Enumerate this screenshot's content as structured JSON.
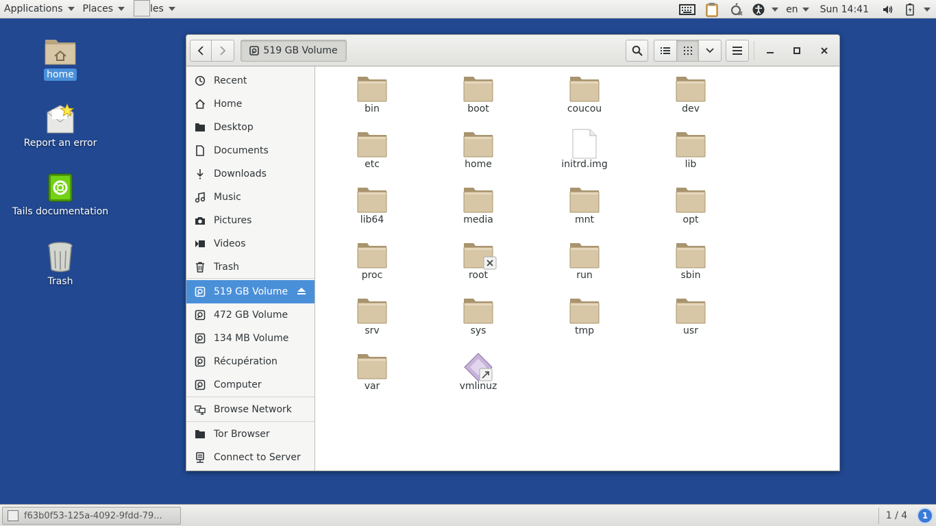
{
  "topbar": {
    "applications": "Applications",
    "places": "Places",
    "files": "Files",
    "lang": "en",
    "clock": "Sun 14:41"
  },
  "desktop": {
    "icons": [
      {
        "label": "home",
        "icon": "home-folder-icon",
        "selected": true
      },
      {
        "label": "Report an error",
        "icon": "report-error-icon"
      },
      {
        "label": "Tails documentation",
        "icon": "documentation-icon"
      },
      {
        "label": "Trash",
        "icon": "trash-icon"
      }
    ]
  },
  "window": {
    "location": "519 GB Volume",
    "view_mode": "grid"
  },
  "sidebar": {
    "items": [
      {
        "label": "Recent",
        "icon": "clock-icon"
      },
      {
        "label": "Home",
        "icon": "home-icon"
      },
      {
        "label": "Desktop",
        "icon": "folder-icon"
      },
      {
        "label": "Documents",
        "icon": "document-icon"
      },
      {
        "label": "Downloads",
        "icon": "download-icon"
      },
      {
        "label": "Music",
        "icon": "music-icon"
      },
      {
        "label": "Pictures",
        "icon": "camera-icon"
      },
      {
        "label": "Videos",
        "icon": "video-icon"
      },
      {
        "label": "Trash",
        "icon": "trash-icon"
      },
      {
        "label": "519 GB Volume",
        "icon": "drive-icon",
        "selected": true
      },
      {
        "label": "472 GB Volume",
        "icon": "drive-icon"
      },
      {
        "label": "134 MB Volume",
        "icon": "drive-icon"
      },
      {
        "label": "Récupération",
        "icon": "drive-icon"
      },
      {
        "label": "Computer",
        "icon": "drive-icon"
      },
      {
        "label": "Browse Network",
        "icon": "network-icon"
      },
      {
        "label": "Tor Browser",
        "icon": "folder-icon"
      },
      {
        "label": "Connect to Server",
        "icon": "server-icon"
      }
    ]
  },
  "files": [
    {
      "name": "bin",
      "type": "folder"
    },
    {
      "name": "boot",
      "type": "folder"
    },
    {
      "name": "coucou",
      "type": "folder"
    },
    {
      "name": "dev",
      "type": "folder"
    },
    {
      "name": "etc",
      "type": "folder"
    },
    {
      "name": "home",
      "type": "folder"
    },
    {
      "name": "initrd.img",
      "type": "file"
    },
    {
      "name": "lib",
      "type": "folder"
    },
    {
      "name": "lib64",
      "type": "folder"
    },
    {
      "name": "media",
      "type": "folder"
    },
    {
      "name": "mnt",
      "type": "folder"
    },
    {
      "name": "opt",
      "type": "folder"
    },
    {
      "name": "proc",
      "type": "folder"
    },
    {
      "name": "root",
      "type": "folder-locked"
    },
    {
      "name": "run",
      "type": "folder"
    },
    {
      "name": "sbin",
      "type": "folder"
    },
    {
      "name": "srv",
      "type": "folder"
    },
    {
      "name": "sys",
      "type": "folder"
    },
    {
      "name": "tmp",
      "type": "folder"
    },
    {
      "name": "usr",
      "type": "folder"
    },
    {
      "name": "var",
      "type": "folder"
    },
    {
      "name": "vmlinuz",
      "type": "link"
    }
  ],
  "taskbar": {
    "task": "f63b0f53-125a-4092-9fdd-79...",
    "pager": "1 / 4",
    "notifications": "1"
  },
  "colors": {
    "desktop_bg": "#214891",
    "selection": "#4a90d9",
    "folder": "#d8c7a6"
  }
}
